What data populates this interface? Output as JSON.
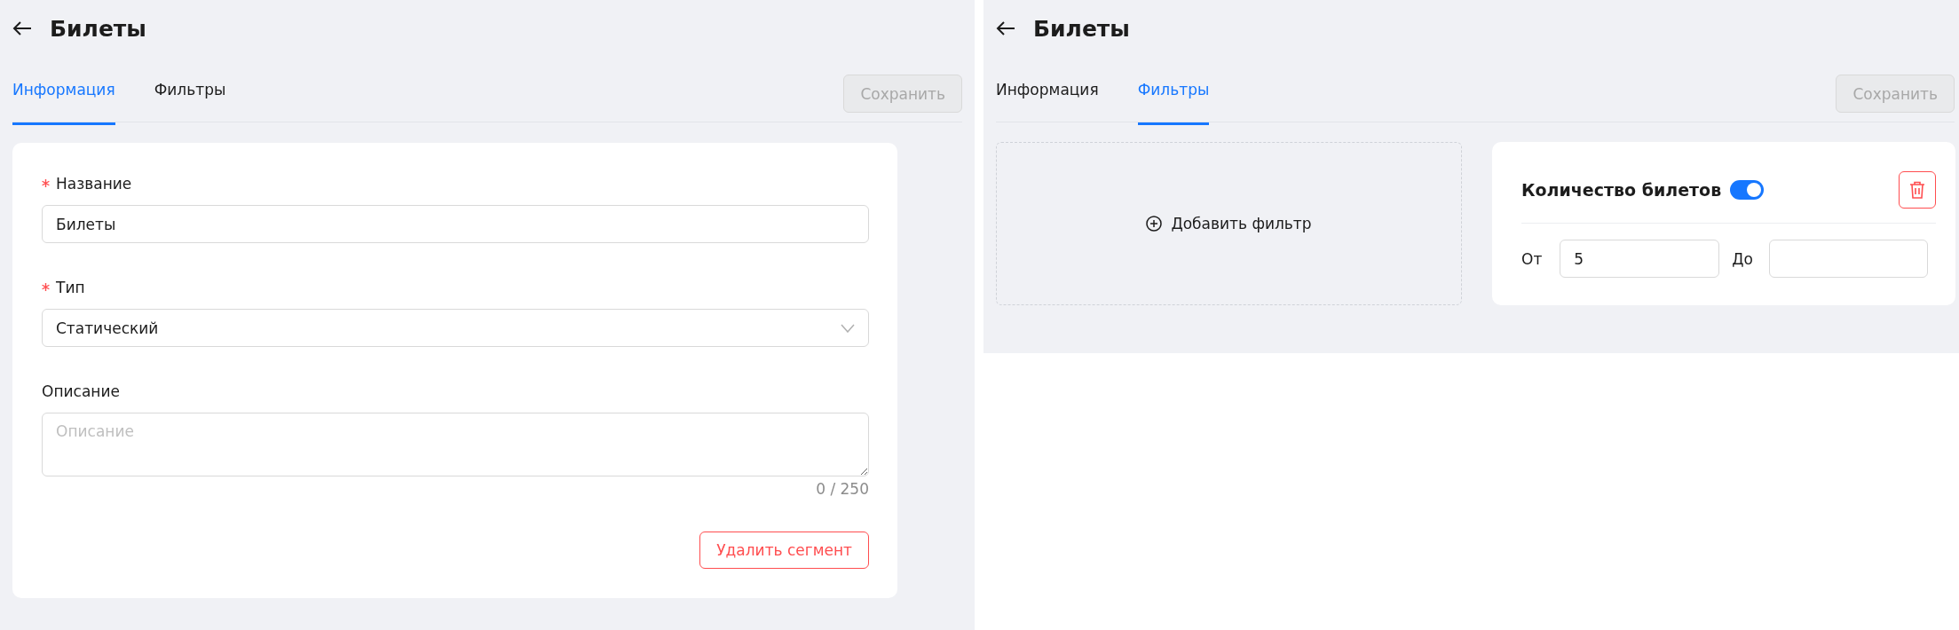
{
  "views": [
    {
      "kind": "info",
      "title": "Билеты",
      "tabs": [
        {
          "label": "Информация",
          "selected": true
        },
        {
          "label": "Фильтры",
          "selected": false
        }
      ],
      "save_button": {
        "label": "Сохранить",
        "disabled": true
      },
      "form": {
        "fields": [
          {
            "kind": "text",
            "label": "Название",
            "required": true,
            "value": "Билеты"
          },
          {
            "kind": "select",
            "label": "Тип",
            "required": true,
            "value": "Статический"
          },
          {
            "kind": "textarea",
            "label": "Описание",
            "required": false,
            "placeholder": "Описание",
            "counter": "0 / 250"
          }
        ],
        "delete_button": "Удалить сегмент"
      }
    },
    {
      "kind": "filters",
      "title": "Билеты",
      "tabs": [
        {
          "label": "Информация",
          "selected": false
        },
        {
          "label": "Фильтры",
          "selected": true
        }
      ],
      "save_button": {
        "label": "Сохранить",
        "disabled": true
      },
      "add_filter": "Добавить фильтр",
      "filter_card": {
        "title": "Количество билетов",
        "on": true,
        "from_label": "От",
        "from_value": "5",
        "to_label": "До"
      }
    }
  ]
}
